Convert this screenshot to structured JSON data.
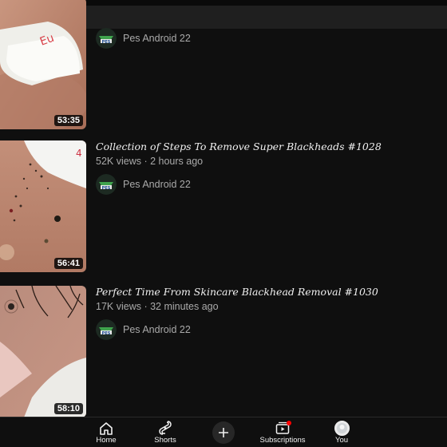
{
  "videos": [
    {
      "title": "",
      "meta": "",
      "channel": "Pes Android 22",
      "duration": "53:35"
    },
    {
      "title": "Collection of Steps To Remove Super Blackheads #1028",
      "meta": "52K views · 2 hours ago",
      "channel": "Pes Android 22",
      "duration": "56:41"
    },
    {
      "title": "Perfect Time From Skincare Blackhead Removal #1030",
      "meta": "17K views · 32 minutes ago",
      "channel": "Pes Android 22",
      "duration": "58:10"
    }
  ],
  "nav": {
    "home": "Home",
    "shorts": "Shorts",
    "subscriptions": "Subscriptions",
    "you": "You"
  },
  "icons": {
    "home": "home-icon",
    "shorts": "shorts-icon",
    "create": "plus-icon",
    "subscriptions": "subscriptions-icon",
    "you": "avatar-icon"
  },
  "colors": {
    "background": "#0f0f0f",
    "notification_dot": "#ff0000"
  }
}
